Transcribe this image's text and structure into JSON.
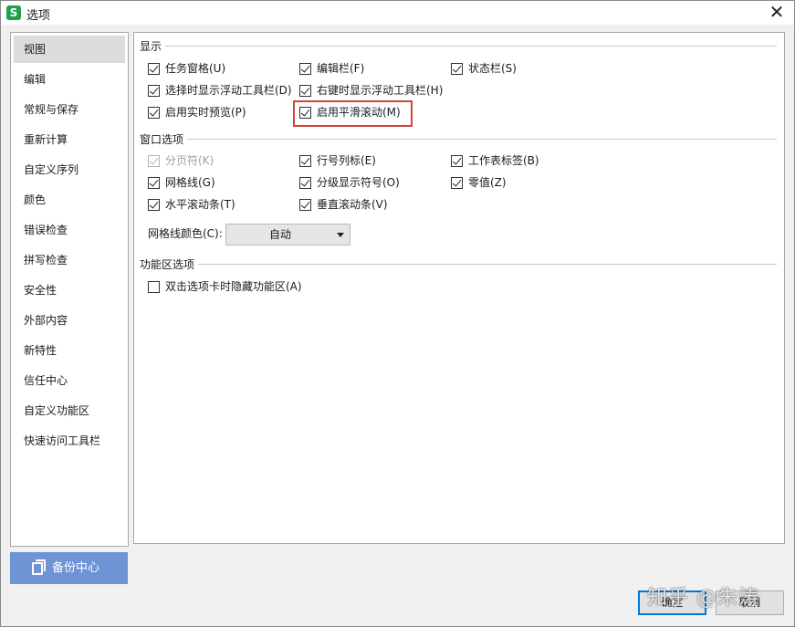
{
  "window": {
    "title": "选项",
    "app_icon_letter": "S",
    "close_glyph": "✕"
  },
  "sidebar": {
    "items": [
      {
        "label": "视图",
        "active": true
      },
      {
        "label": "编辑"
      },
      {
        "label": "常规与保存"
      },
      {
        "label": "重新计算"
      },
      {
        "label": "自定义序列"
      },
      {
        "label": "颜色"
      },
      {
        "label": "错误检查"
      },
      {
        "label": "拼写检查"
      },
      {
        "label": "安全性"
      },
      {
        "label": "外部内容"
      },
      {
        "label": "新特性"
      },
      {
        "label": "信任中心"
      },
      {
        "label": "自定义功能区"
      },
      {
        "label": "快速访问工具栏"
      }
    ],
    "backup_button": "备份中心"
  },
  "display": {
    "title": "显示",
    "options": [
      {
        "label": "任务窗格(U)",
        "checked": true
      },
      {
        "label": "编辑栏(F)",
        "checked": true
      },
      {
        "label": "状态栏(S)",
        "checked": true
      },
      {
        "label": "选择时显示浮动工具栏(D)",
        "checked": true
      },
      {
        "label": "右键时显示浮动工具栏(H)",
        "checked": true
      },
      {
        "label": "启用实时预览(P)",
        "checked": true
      },
      {
        "label": "启用平滑滚动(M)",
        "checked": true,
        "highlighted": true
      }
    ]
  },
  "window_options": {
    "title": "窗口选项",
    "options": [
      {
        "label": "分页符(K)",
        "checked": true,
        "disabled": true
      },
      {
        "label": "行号列标(E)",
        "checked": true
      },
      {
        "label": "工作表标签(B)",
        "checked": true
      },
      {
        "label": "网格线(G)",
        "checked": true
      },
      {
        "label": "分级显示符号(O)",
        "checked": true
      },
      {
        "label": "零值(Z)",
        "checked": true
      },
      {
        "label": "水平滚动条(T)",
        "checked": true
      },
      {
        "label": "垂直滚动条(V)",
        "checked": true
      }
    ],
    "gridline_color_label": "网格线颜色(C):",
    "gridline_color_value": "自动"
  },
  "ribbon": {
    "title": "功能区选项",
    "options": [
      {
        "label": "双击选项卡时隐藏功能区(A)",
        "checked": false
      }
    ]
  },
  "footer": {
    "ok_label": "确定",
    "cancel_label": "取消"
  },
  "watermark": "知乎 @朱涛",
  "colors": {
    "highlight_border": "#d2433b",
    "backup_button_bg": "#6f94d6",
    "app_icon_bg": "#1fa14b"
  }
}
